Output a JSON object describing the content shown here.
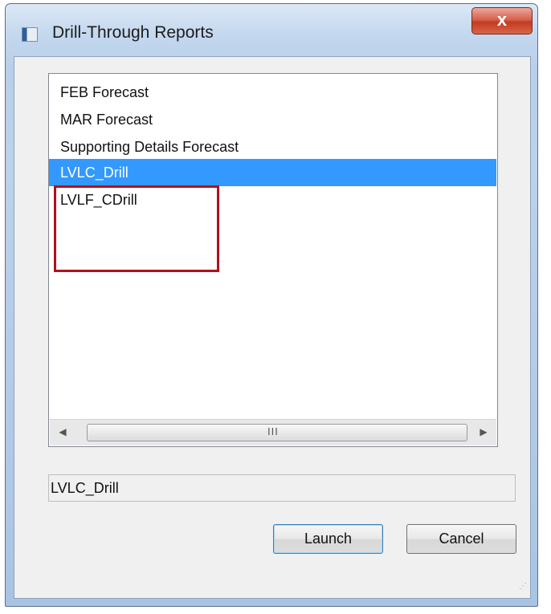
{
  "window": {
    "title": "Drill-Through Reports",
    "close_label": "x"
  },
  "list": {
    "items": [
      {
        "label": "FEB Forecast",
        "selected": false
      },
      {
        "label": "MAR Forecast",
        "selected": false
      },
      {
        "label": "Supporting Details Forecast",
        "selected": false
      },
      {
        "label": "LVLC_Drill",
        "selected": true
      },
      {
        "label": "LVLF_CDrill",
        "selected": false
      }
    ],
    "highlight_color": "#b3101a",
    "selection_color": "#3399ff"
  },
  "scrollbar": {
    "left_arrow": "◀",
    "right_arrow": "▶",
    "grip": "III"
  },
  "selection_field": {
    "value": "LVLC_Drill"
  },
  "buttons": {
    "launch_label": "Launch",
    "cancel_label": "Cancel"
  },
  "icons": {
    "app": "app-window-icon",
    "close": "close-icon"
  }
}
